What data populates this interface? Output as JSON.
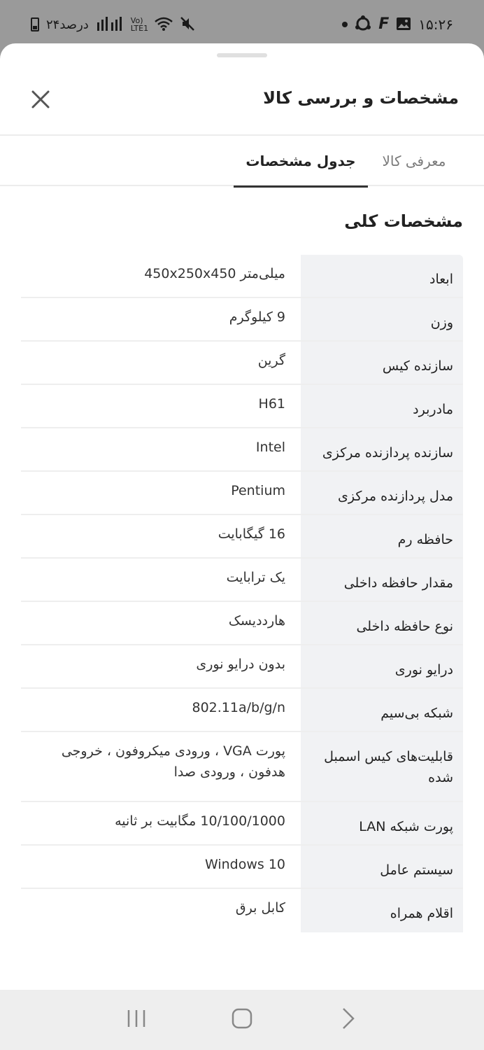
{
  "status_bar": {
    "time": "۱۵:۲۶",
    "battery": "۲۴درصد",
    "network": "Vo) LTE1"
  },
  "header": {
    "title": "مشخصات و بررسی کالا"
  },
  "tabs": [
    {
      "label": "معرفی کالا",
      "active": false
    },
    {
      "label": "جدول مشخصات",
      "active": true
    }
  ],
  "section": {
    "title": "مشخصات کلی"
  },
  "specs": [
    {
      "key": "ابعاد",
      "value": "میلی‌متر 450x250x450"
    },
    {
      "key": "وزن",
      "value": "9 کیلوگرم"
    },
    {
      "key": "سازنده کیس",
      "value": "گرین"
    },
    {
      "key": "مادربرد",
      "value": "H61"
    },
    {
      "key": "سازنده پردازنده مرکزی",
      "value": "Intel"
    },
    {
      "key": "مدل پردازنده مرکزی",
      "value": "Pentium"
    },
    {
      "key": "حافظه رم",
      "value": "16 گیگابایت"
    },
    {
      "key": "مقدار حافظه داخلی",
      "value": "یک ترابایت"
    },
    {
      "key": "نوع حافظه داخلی",
      "value": "هارددیسک"
    },
    {
      "key": "درایو نوری",
      "value": "بدون درایو نوری"
    },
    {
      "key": "شبکه بی‌سیم",
      "value": "802.11a/b/g/n"
    },
    {
      "key": "قابلیت‌های کیس اسمبل شده",
      "value": "پورت VGA ، ورودی میکروفون ، خروجی هدفون ، ورودی صدا"
    },
    {
      "key": "پورت شبکه LAN",
      "value": "10/100/1000 مگابیت بر ثانیه"
    },
    {
      "key": "سیستم عامل",
      "value": "Windows 10"
    },
    {
      "key": "اقلام همراه",
      "value": "کابل برق"
    }
  ],
  "colors": {
    "sheet_bg": "#ffffff",
    "key_bg": "#f1f2f4",
    "divider": "#eeeeee",
    "status_bg": "#9a9a9a"
  }
}
